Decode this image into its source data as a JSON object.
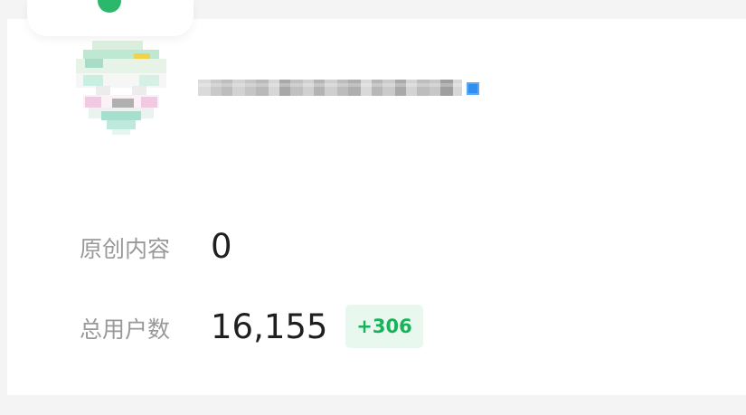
{
  "profile": {
    "nickname_redacted": true,
    "verified": true
  },
  "stats": {
    "original_content_label": "原创内容",
    "original_content_value": "0",
    "total_users_label": "总用户数",
    "total_users_value": "16,155",
    "total_users_delta": "+306"
  },
  "colors": {
    "label": "#999999",
    "value": "#1f1f1f",
    "delta_text": "#17b35a",
    "delta_bg": "#e9f8ef",
    "status_dot": "#2bb86a"
  },
  "icons": {
    "avatar": "pixelated-avatar-icon",
    "verified": "verified-badge-icon"
  }
}
